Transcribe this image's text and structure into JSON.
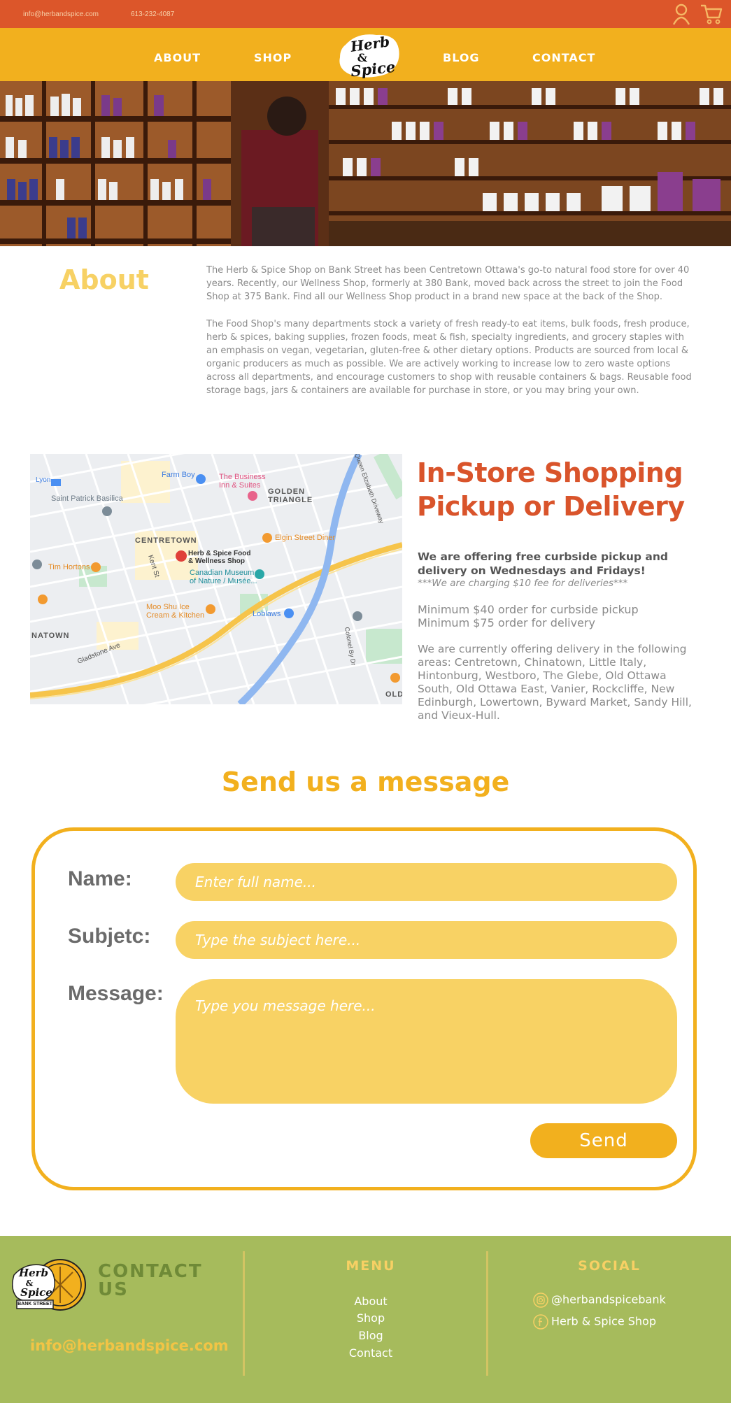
{
  "topbar": {
    "email": "info@herbandspice.com",
    "phone": "613-232-4087",
    "icons": [
      "user-icon",
      "cart-icon"
    ]
  },
  "nav": {
    "items": [
      {
        "label": "ABOUT"
      },
      {
        "label": "SHOP"
      },
      {
        "label": "BLOG"
      },
      {
        "label": "CONTACT"
      }
    ],
    "logo": {
      "line1": "Herb",
      "line2": "&",
      "line3": "Spice"
    }
  },
  "about": {
    "title": "About",
    "paragraph1": "The Herb & Spice Shop on Bank Street has been Centretown Ottawa's go-to natural food store for over 40 years. Recently, our Wellness Shop, formerly at 380 Bank, moved back across the street to join the Food Shop at 375 Bank. Find all our Wellness Shop product in a brand new space at the back of the Shop.",
    "paragraph2": "The Food Shop's many departments stock a variety of fresh ready-to eat items, bulk foods, fresh produce, herb & spices, baking supplies, frozen foods, meat & fish, specialty ingredients, and grocery staples with an emphasis on vegan, vegetarian, gluten-free & other dietary options. Products are sourced from local & organic producers as much as possible. We are actively working to increase low to zero waste options across all departments, and encourage customers to shop with reusable containers & bags. Reusable food storage bags, jars & containers are available for purchase in store, or you may bring your own."
  },
  "map": {
    "labels": {
      "centretown": "CENTRETOWN",
      "golden_triangle": "GOLDEN\nTRIANGLE",
      "store": "Herb & Spice Food\n& Wellness Shop",
      "museum": "Canadian Museum\nof Nature / Musée...",
      "business_inn": "The Business\nInn & Suites",
      "farm_boy": "Farm Boy",
      "saint_patrick": "Saint Patrick Basilica",
      "tim_hortons": "Tim Hortons",
      "elgin_diner": "Elgin Street Diner",
      "moo_shu": "Moo Shu Ice\nCream & Kitchen",
      "loblaws": "Loblaws",
      "lyon": "Lyon",
      "natown": "NATOWN",
      "old": "OLD",
      "kent_st": "Kent St",
      "gladstone": "Gladstone Ave",
      "queen_eliz": "Queen Elizabeth Driveway",
      "colonel_by": "Colonel By Dr"
    }
  },
  "shopping": {
    "title": "In-Store Shopping Pickup or Delivery",
    "bold": "We are offering free curbside pickup and delivery on Wednesdays and Fridays!",
    "note": "***We are charging $10 fee for deliveries***",
    "min_pickup": "Minimum $40 order for curbside pickup",
    "min_delivery": "Minimum $75 order for delivery",
    "areas": "We are currently offering delivery in the following areas: Centretown, Chinatown, Little Italy, Hintonburg, Westboro, The Glebe, Old Ottawa South, Old Ottawa East, Vanier, Rockcliffe, New Edinburgh, Lowertown, Byward Market, Sandy Hill, and Vieux-Hull."
  },
  "contact_form": {
    "title": "Send us a message",
    "name_label": "Name:",
    "name_placeholder": "Enter full name...",
    "subject_label": "Subjetc:",
    "subject_placeholder": "Type the subject here...",
    "message_label": "Message:",
    "message_placeholder": "Type you message here...",
    "send_label": "Send"
  },
  "footer": {
    "logo": {
      "line1": "Herb",
      "line2": "&",
      "line3": "Spice",
      "badge": "BANK STREET"
    },
    "contact_title_1": "CONTACT",
    "contact_title_2": "US",
    "email": "info@herbandspice.com",
    "menu_title": "MENU",
    "menu_items": [
      "About",
      "Shop",
      "Blog",
      "Contact"
    ],
    "social_title": "SOCIAL",
    "instagram": "@herbandspicebank",
    "facebook": "Herb & Spice Shop"
  },
  "colors": {
    "topbar": "#dc562a",
    "nav": "#f2b01e",
    "about_title": "#f7d164",
    "shop_title": "#d9542b",
    "field": "#f8d264",
    "footer": "#a6bb5c"
  }
}
